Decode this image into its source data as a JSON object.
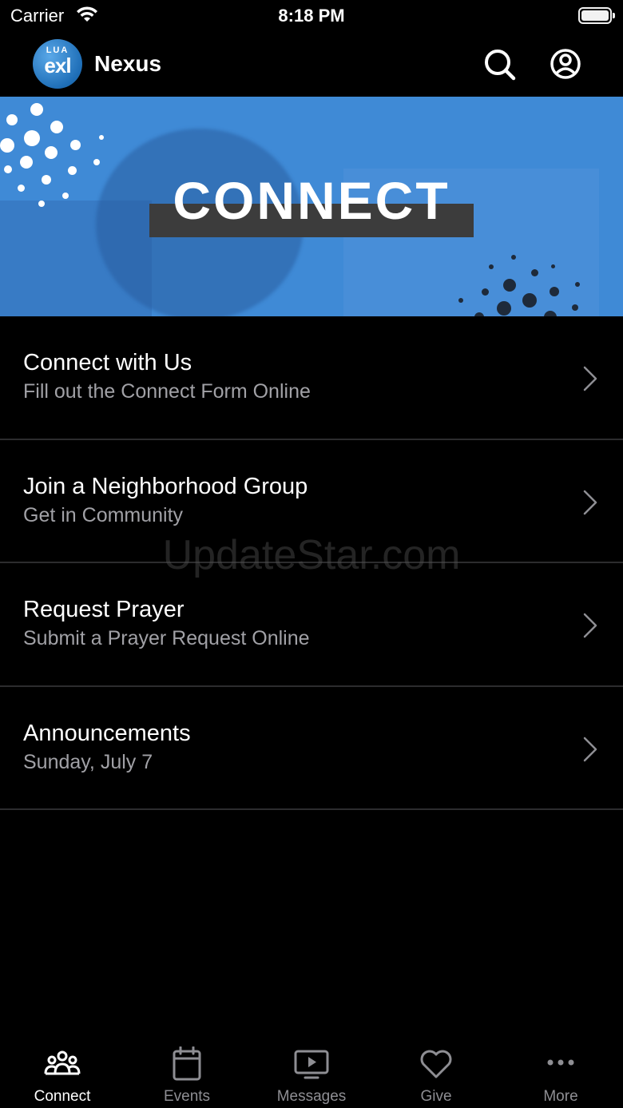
{
  "status_bar": {
    "carrier": "Carrier",
    "time": "8:18 PM",
    "battery_level": 1.0
  },
  "header": {
    "logo_text_top": "LUA",
    "logo_text_main": "exl",
    "app_title": "Nexus",
    "icons": [
      "search-icon",
      "profile-icon"
    ]
  },
  "banner": {
    "title": "CONNECT"
  },
  "list": [
    {
      "title": "Connect with Us",
      "subtitle": "Fill out the Connect Form Online"
    },
    {
      "title": "Join a Neighborhood Group",
      "subtitle": "Get in Community"
    },
    {
      "title": "Request Prayer",
      "subtitle": "Submit a Prayer Request Online"
    },
    {
      "title": "Announcements",
      "subtitle": "Sunday, July 7"
    }
  ],
  "watermark": "UpdateStar.com",
  "tabs": [
    {
      "label": "Connect",
      "icon": "people-icon",
      "active": true
    },
    {
      "label": "Events",
      "icon": "calendar-icon",
      "active": false
    },
    {
      "label": "Messages",
      "icon": "play-screen-icon",
      "active": false
    },
    {
      "label": "Give",
      "icon": "heart-icon",
      "active": false
    },
    {
      "label": "More",
      "icon": "more-icon",
      "active": false
    }
  ],
  "colors": {
    "background": "#000000",
    "banner": "#3f8ad6",
    "tab_inactive": "#8e8e93",
    "subtitle": "#a1a1a6"
  }
}
